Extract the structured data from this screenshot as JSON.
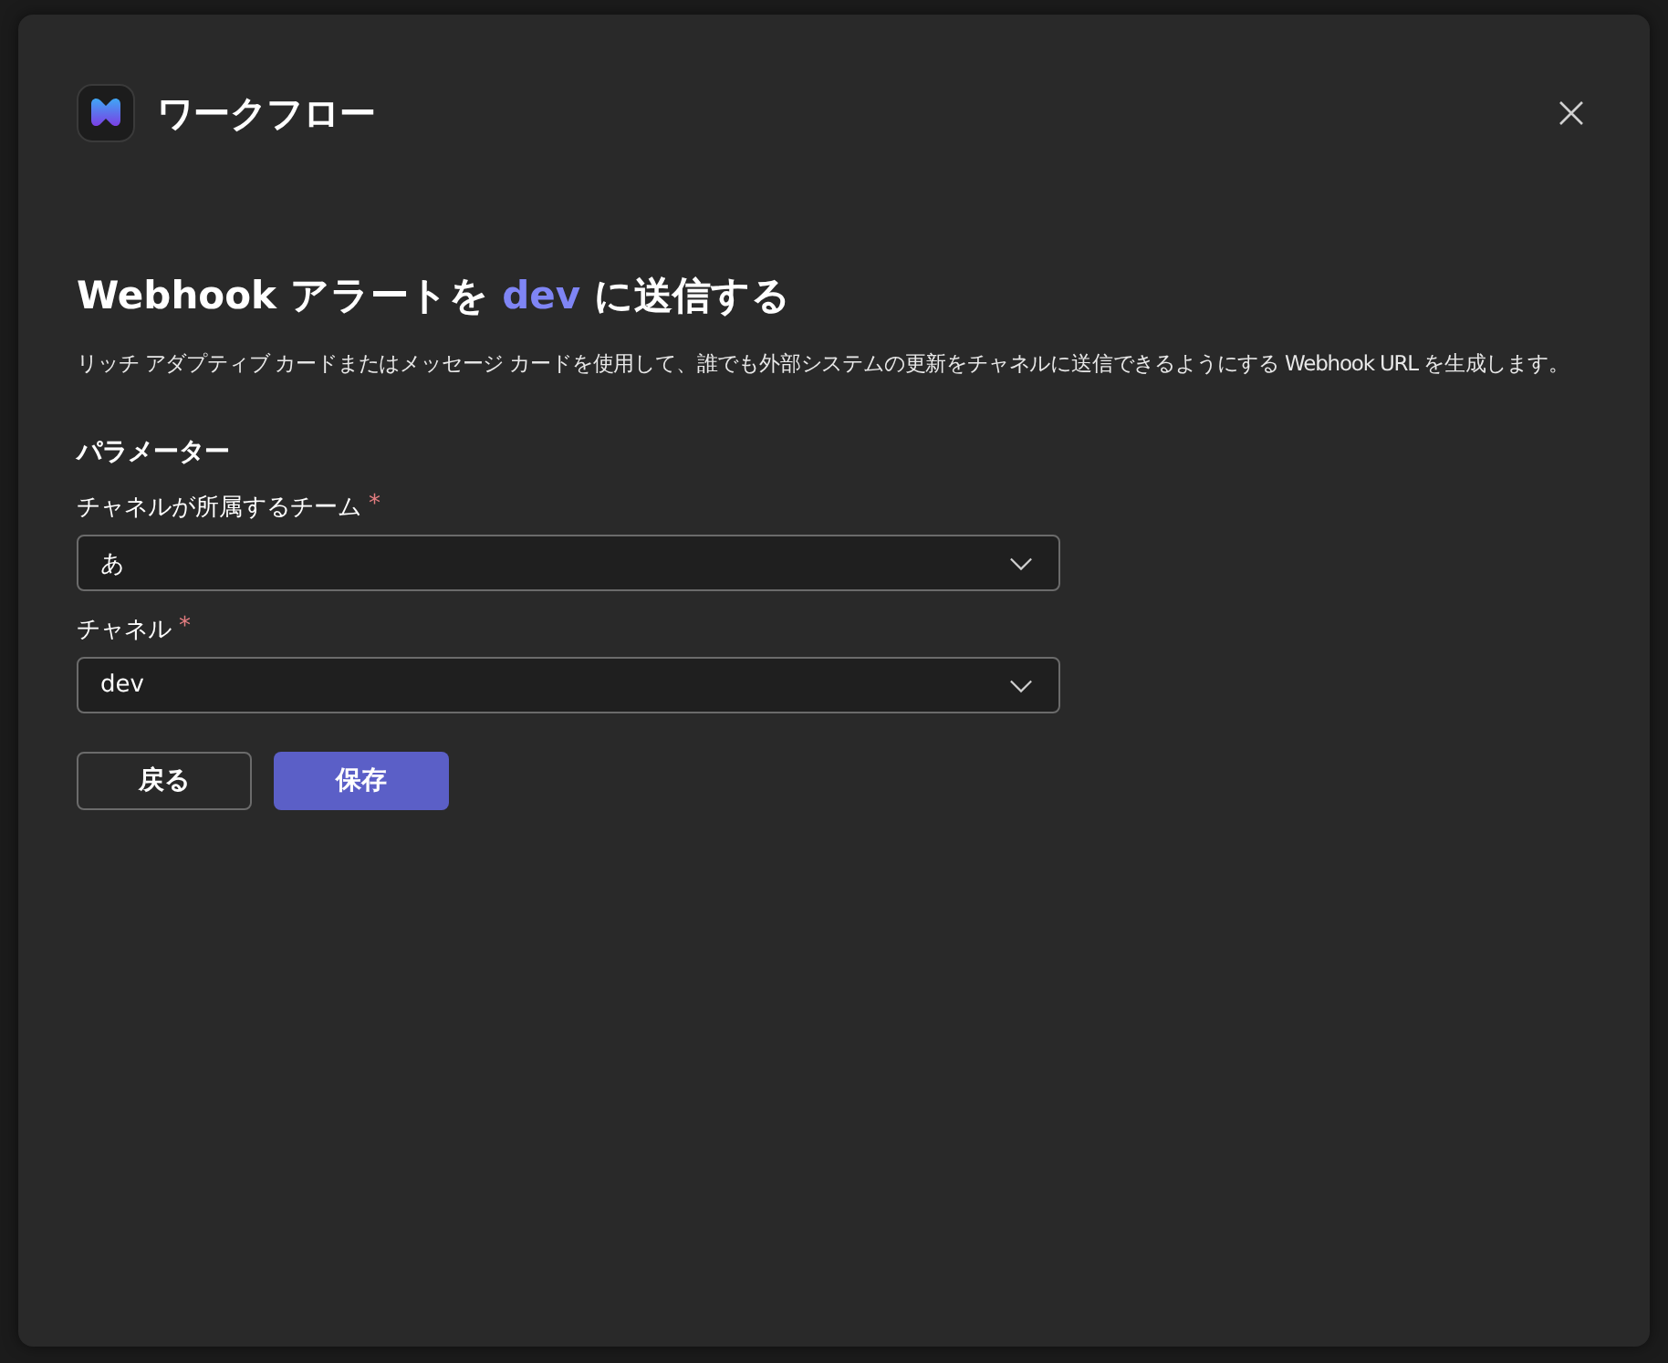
{
  "dialog": {
    "title": "ワークフロー",
    "heading": {
      "before": "Webhook アラートを ",
      "highlight": "dev",
      "after": " に送信する"
    },
    "description": "リッチ アダプティブ カードまたはメッセージ カードを使用して、誰でも外部システムの更新をチャネルに送信できるようにする Webhook URL を生成します。",
    "section_title": "パラメーター",
    "fields": [
      {
        "label": "チャネルが所属するチーム",
        "required_mark": "*",
        "value": "あ"
      },
      {
        "label": "チャネル",
        "required_mark": "*",
        "value": "dev"
      }
    ],
    "buttons": [
      {
        "label": "戻る",
        "kind": "secondary"
      },
      {
        "label": "保存",
        "kind": "primary"
      }
    ]
  }
}
